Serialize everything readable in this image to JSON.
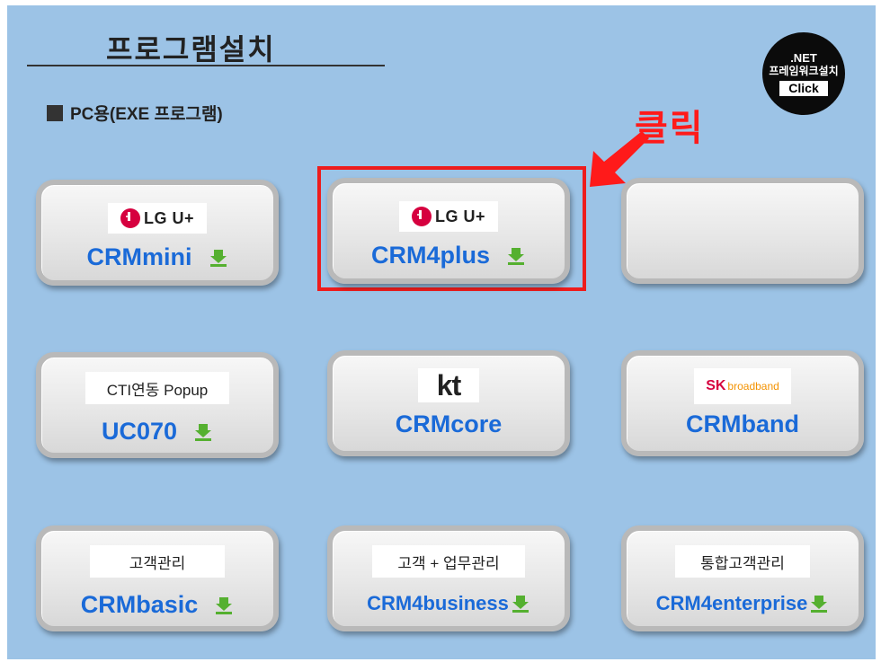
{
  "header": {
    "title": "프로그램설치",
    "section_label": "PC용(EXE 프로그램)"
  },
  "net_badge": {
    "line1": ".NET",
    "line2": "프레임워크설치",
    "button": "Click"
  },
  "annotation": {
    "click_text": "클릭",
    "arrow_color": "#ff1a1a",
    "highlight_color": "#ee1c1c"
  },
  "colors": {
    "background": "#9cc3e6",
    "product_text": "#1a6ad8",
    "download_icon": "#55b030"
  },
  "cards": [
    {
      "logo": "LG U+",
      "product": "CRMmini",
      "icon": "download-icon"
    },
    {
      "logo": "LG U+",
      "product": "CRM4plus",
      "icon": "download-icon"
    },
    {
      "logo": "",
      "product": ""
    },
    {
      "label": "CTI연동 Popup",
      "product": "UC070",
      "icon": "download-icon"
    },
    {
      "logo": "kt",
      "product": "CRMcore"
    },
    {
      "logo_main": "SK",
      "logo_sub": "broadband",
      "product": "CRMband"
    },
    {
      "label": "고객관리",
      "product": "CRMbasic",
      "icon": "download-icon"
    },
    {
      "label": "고객 + 업무관리",
      "product": "CRM4business",
      "icon": "download-icon"
    },
    {
      "label": "통합고객관리",
      "product": "CRM4enterprise",
      "icon": "download-icon"
    }
  ]
}
